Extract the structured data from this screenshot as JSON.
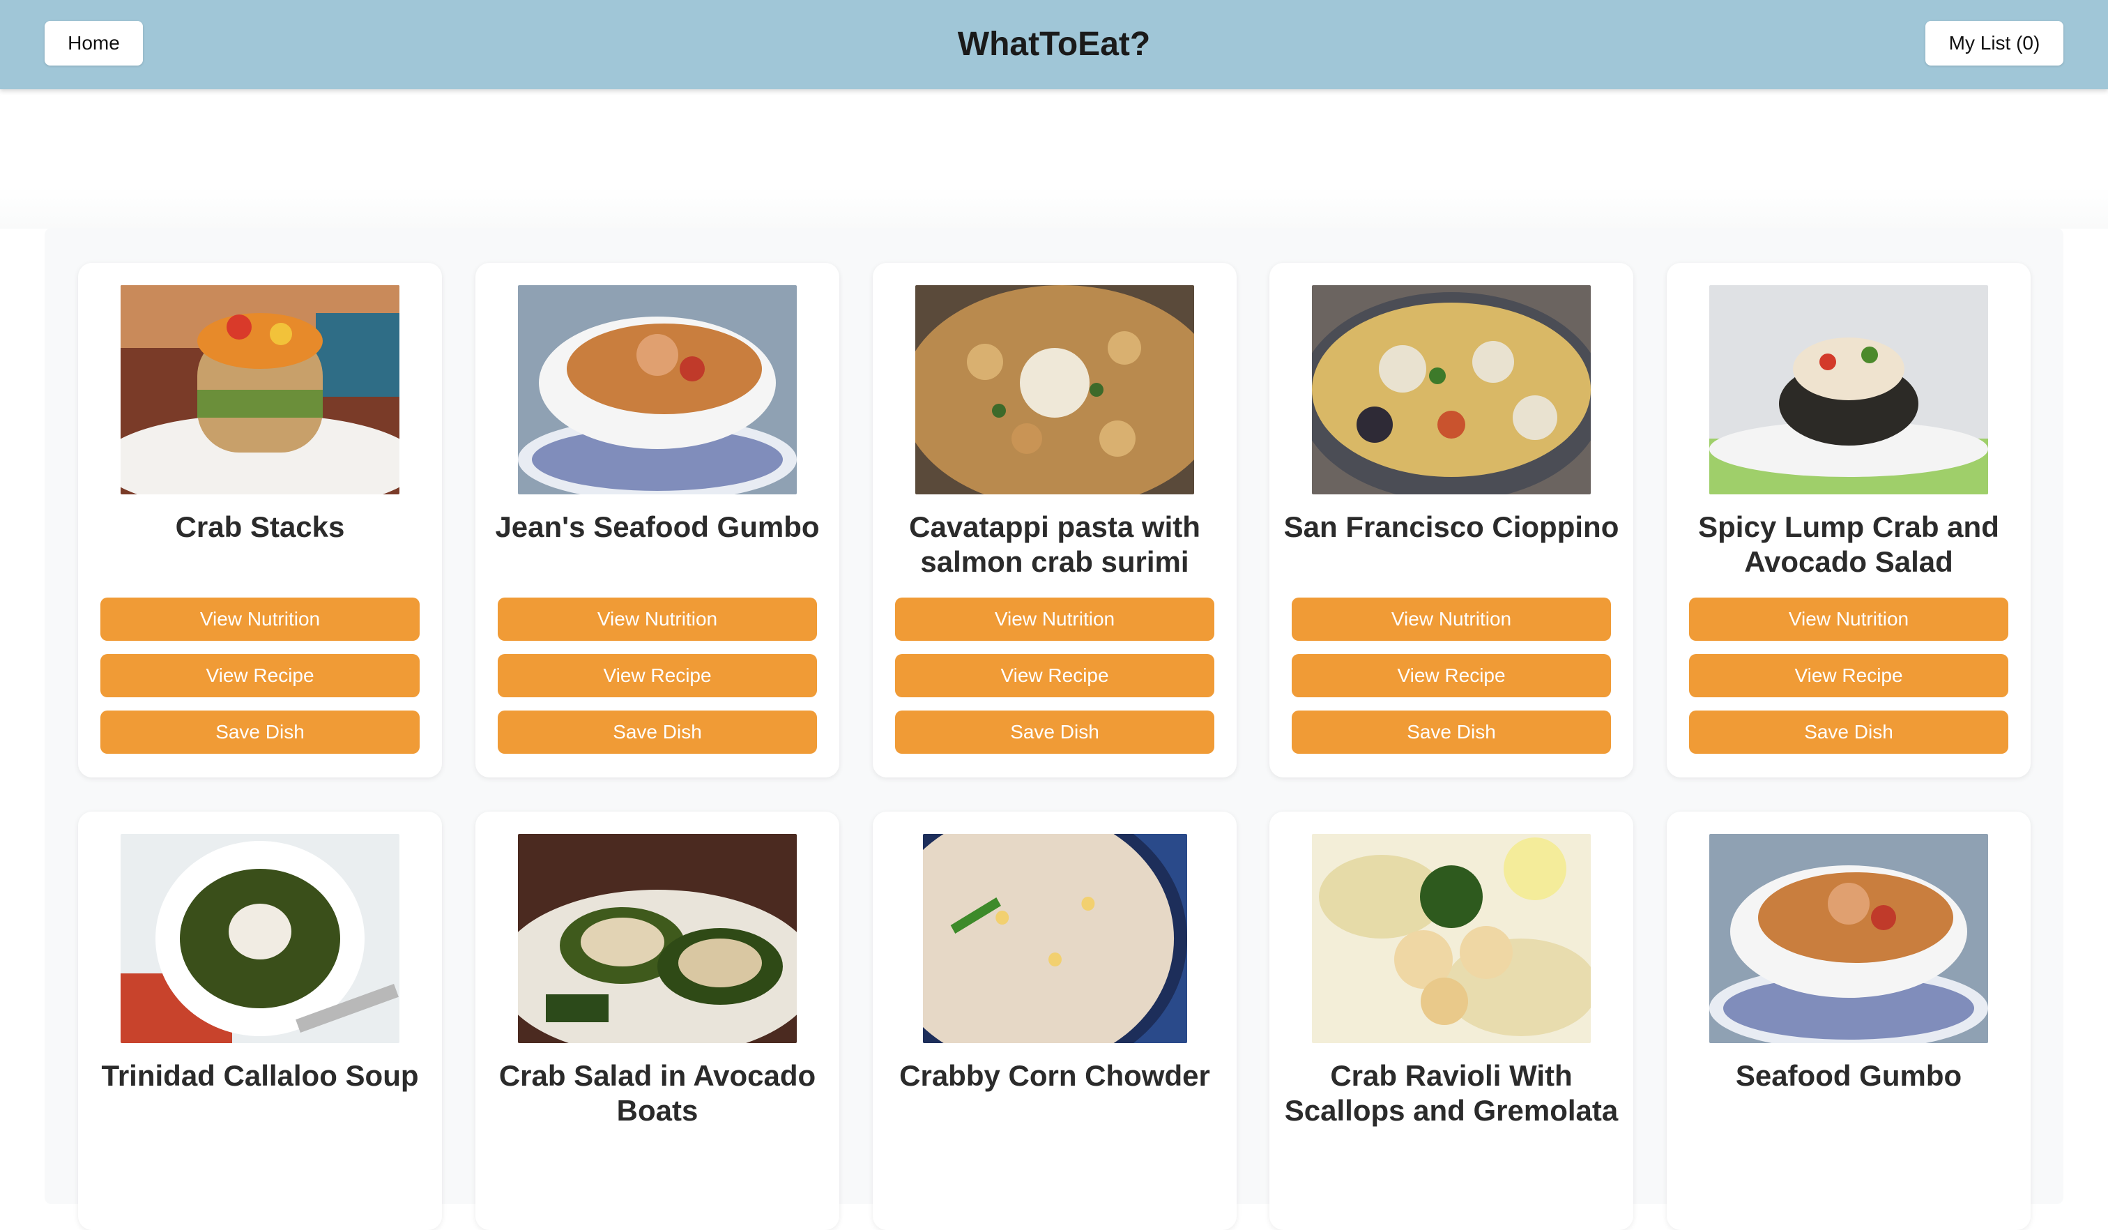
{
  "header": {
    "home_label": "Home",
    "title": "WhatToEat?",
    "my_list_label": "My List (0)"
  },
  "buttons": {
    "view_nutrition": "View Nutrition",
    "view_recipe": "View Recipe",
    "save_dish": "Save Dish"
  },
  "colors": {
    "header_bg": "#a0c6d7",
    "accent": "#f09b36"
  },
  "dishes": [
    {
      "name": "Crab Stacks",
      "icon": "crab-stack-photo"
    },
    {
      "name": "Jean's Seafood Gumbo",
      "icon": "gumbo-bowl-photo"
    },
    {
      "name": "Cavatappi pasta with salmon crab surimi",
      "icon": "pasta-photo"
    },
    {
      "name": "San Francisco Cioppino",
      "icon": "cioppino-pan-photo"
    },
    {
      "name": "Spicy Lump Crab and Avocado Salad",
      "icon": "avocado-crab-photo"
    },
    {
      "name": "Trinidad Callaloo Soup",
      "icon": "callaloo-soup-photo"
    },
    {
      "name": "Crab Salad in Avocado Boats",
      "icon": "avocado-boats-photo"
    },
    {
      "name": "Crabby Corn Chowder",
      "icon": "corn-chowder-photo"
    },
    {
      "name": "Crab Ravioli With Scallops and Gremolata",
      "icon": "ravioli-scallops-photo"
    },
    {
      "name": "Seafood Gumbo",
      "icon": "seafood-gumbo-photo"
    }
  ]
}
